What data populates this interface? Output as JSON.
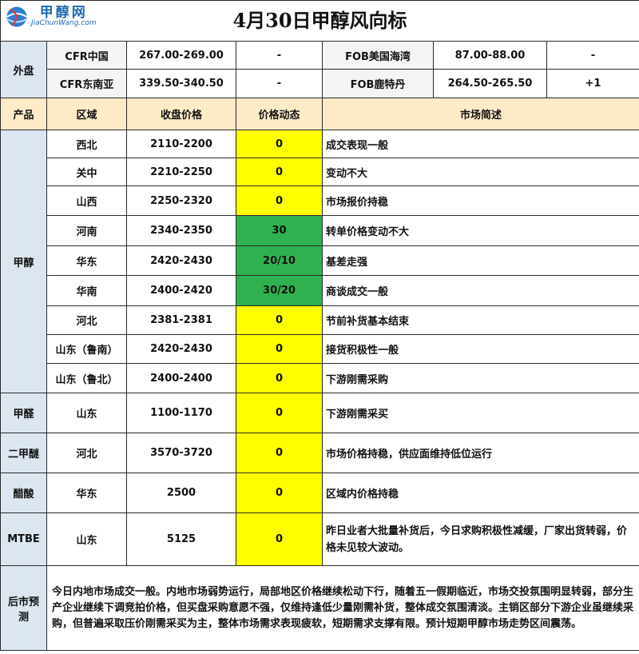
{
  "title": "4月30日甲醇风向标",
  "logo": {
    "cn": "甲醇网",
    "url": "JiaChunWang.com"
  },
  "foreign": {
    "label": "外盘",
    "rows": [
      {
        "left_name": "CFR中国",
        "left_price": "267.00-269.00",
        "left_change": "-",
        "right_name": "FOB美国海湾",
        "right_price": "87.00-88.00",
        "right_change": "-"
      },
      {
        "left_name": "CFR东南亚",
        "left_price": "339.50-340.50",
        "left_change": "-",
        "right_name": "FOB鹿特丹",
        "right_price": "264.50-265.50",
        "right_change": "+1"
      }
    ]
  },
  "header": {
    "product": "产品",
    "region": "区域",
    "price": "收盘价格",
    "dynamic": "价格动态",
    "summary": "市场简述"
  },
  "colors": {
    "yellow": "#ffff00",
    "green": "#2fb14f",
    "header_bg": "#fdebc8",
    "category_bg": "#dbe6f1"
  },
  "methanol": {
    "product": "甲醇",
    "rows": [
      {
        "region": "西北",
        "price": "2110-2200",
        "dynamic": "0",
        "summary": "成交表现一般",
        "color": "yellow"
      },
      {
        "region": "关中",
        "price": "2210-2250",
        "dynamic": "0",
        "summary": "变动不大",
        "color": "yellow"
      },
      {
        "region": "山西",
        "price": "2250-2320",
        "dynamic": "0",
        "summary": "市场报价持稳",
        "color": "yellow"
      },
      {
        "region": "河南",
        "price": "2340-2350",
        "dynamic": "30",
        "summary": "转单价格变动不大",
        "color": "green"
      },
      {
        "region": "华东",
        "price": "2420-2430",
        "dynamic": "20/10",
        "summary": "基差走强",
        "color": "green"
      },
      {
        "region": "华南",
        "price": "2400-2420",
        "dynamic": "30/20",
        "summary": "商谈成交一般",
        "color": "green"
      },
      {
        "region": "河北",
        "price": "2381-2381",
        "dynamic": "0",
        "summary": "节前补货基本结束",
        "color": "yellow"
      },
      {
        "region": "山东（鲁南）",
        "price": "2420-2430",
        "dynamic": "0",
        "summary": "接货积极性一般",
        "color": "yellow"
      },
      {
        "region": "山东（鲁北）",
        "price": "2400-2400",
        "dynamic": "0",
        "summary": "下游刚需采购",
        "color": "yellow"
      }
    ]
  },
  "others": [
    {
      "product": "甲醛",
      "region": "山东",
      "price": "1100-1170",
      "dynamic": "0",
      "summary": "下游刚需采买"
    },
    {
      "product": "二甲醚",
      "region": "河北",
      "price": "3570-3720",
      "dynamic": "0",
      "summary": "市场价格持稳，供应面维持低位运行"
    },
    {
      "product": "醋酸",
      "region": "华东",
      "price": "2500",
      "dynamic": "0",
      "summary": "区域内价格持稳"
    },
    {
      "product": "MTBE",
      "region": "山东",
      "price": "5125",
      "dynamic": "0",
      "summary": "昨日业者大批量补货后，今日求购积极性减缓，厂家出货转弱，价格未见较大波动。"
    }
  ],
  "forecast": {
    "label": "后市预测",
    "text": "今日内地市场成交一般。内地市场弱势运行，局部地区价格继续松动下行，随着五一假期临近，市场交投氛围明显转弱，部分生产企业继续下调竞拍价格，但买盘采购意愿不强，仅维持逢低少量刚需补货，整体成交氛围清淡。主销区部分下游企业虽继续采购，但普遍采取压价刚需采买为主，整体市场需求表现疲软，短期需求支撑有限。预计短期甲醇市场走势区间震荡。"
  }
}
